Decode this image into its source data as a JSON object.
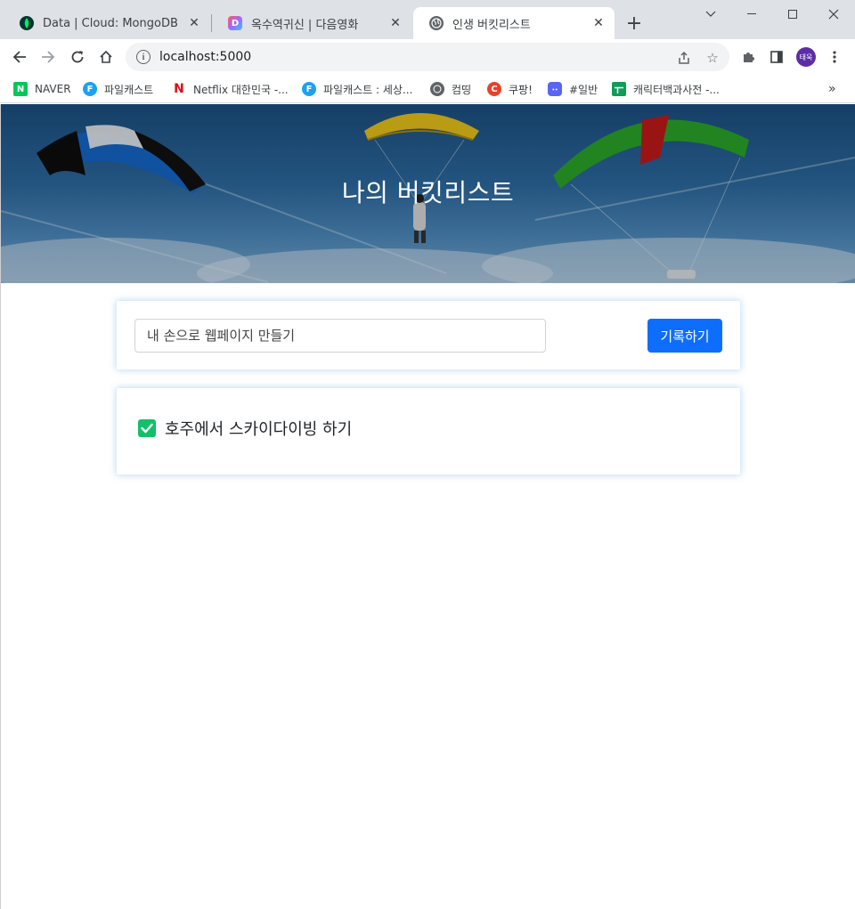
{
  "browser": {
    "tabs": [
      {
        "title": "Data | Cloud: MongoDB Cloud",
        "favicon": "mongodb-leaf-icon",
        "active": false
      },
      {
        "title": "옥수역귀신 | 다음영화",
        "favicon": "daum-movie-icon",
        "active": false
      },
      {
        "title": "인생 버킷리스트",
        "favicon": "globe-icon",
        "active": true
      }
    ],
    "address": "localhost:5000",
    "profile_initials": "태욱",
    "bookmarks": [
      {
        "label": "NAVER",
        "icon": "naver-icon"
      },
      {
        "label": "파일캐스트",
        "icon": "filecast-icon"
      },
      {
        "label": "Netflix 대한민국 -...",
        "icon": "netflix-icon"
      },
      {
        "label": "파일캐스트 : 세상...",
        "icon": "filecast-icon"
      },
      {
        "label": "컴띵",
        "icon": "globe-icon"
      },
      {
        "label": "쿠팡!",
        "icon": "coupang-icon"
      },
      {
        "label": "#일반",
        "icon": "discord-icon"
      },
      {
        "label": "캐릭터백과사전 -...",
        "icon": "sheets-icon"
      }
    ]
  },
  "page": {
    "hero_title": "나의 버킷리스트",
    "input": {
      "value": "",
      "placeholder": "내 손으로 웹페이지 만들기"
    },
    "save_label": "기록하기",
    "bucket_list": [
      {
        "text": "호주에서 스카이다이빙 하기",
        "done": true
      }
    ]
  },
  "colors": {
    "primary_button": "#0d6efd",
    "check_done": "#12c069"
  }
}
